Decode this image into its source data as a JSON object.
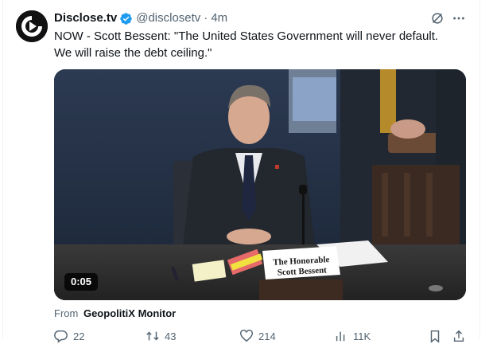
{
  "post": {
    "author_name": "Disclose.tv",
    "handle": "@disclosetv",
    "separator": "·",
    "time": "4m",
    "text": "NOW - Scott Bessent: \"The United States Government will never default.\nWe will raise the debt ceiling.\"",
    "verified_icon": "verified-badge-icon",
    "avatar_icon": "disclose-tv-logo-icon",
    "accent_color": "#1d9bf0"
  },
  "video": {
    "duration": "0:05",
    "placard_line1": "The Honorable",
    "placard_line2": "Scott Bessent"
  },
  "source": {
    "prefix": "From",
    "name": "GeopolitiX Monitor"
  },
  "actions": {
    "replies": "22",
    "reposts": "43",
    "likes": "214",
    "views": "11K"
  }
}
